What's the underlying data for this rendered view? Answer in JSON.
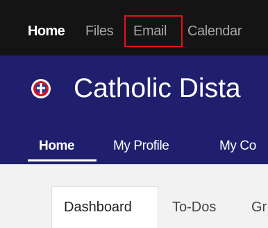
{
  "top_nav": {
    "items": [
      {
        "label": "Home",
        "active": true
      },
      {
        "label": "Files",
        "active": false
      },
      {
        "label": "Email",
        "active": false,
        "highlighted": true
      },
      {
        "label": "Calendar",
        "active": false
      }
    ]
  },
  "header": {
    "title": "Catholic Dista",
    "crest_icon": "school-crest-icon"
  },
  "sub_nav": {
    "items": [
      {
        "label": "Home",
        "active": true
      },
      {
        "label": "My Profile",
        "active": false
      },
      {
        "label": "My Co",
        "active": false
      }
    ]
  },
  "tabs": {
    "items": [
      {
        "label": "Dashboard",
        "active": true
      },
      {
        "label": "To-Dos",
        "active": false
      },
      {
        "label": "Gr",
        "active": false
      }
    ]
  },
  "colors": {
    "topbar_bg": "#141414",
    "banner_bg": "#1f1f6e",
    "highlight": "#e8101a",
    "page_bg": "#f2f2f2"
  }
}
